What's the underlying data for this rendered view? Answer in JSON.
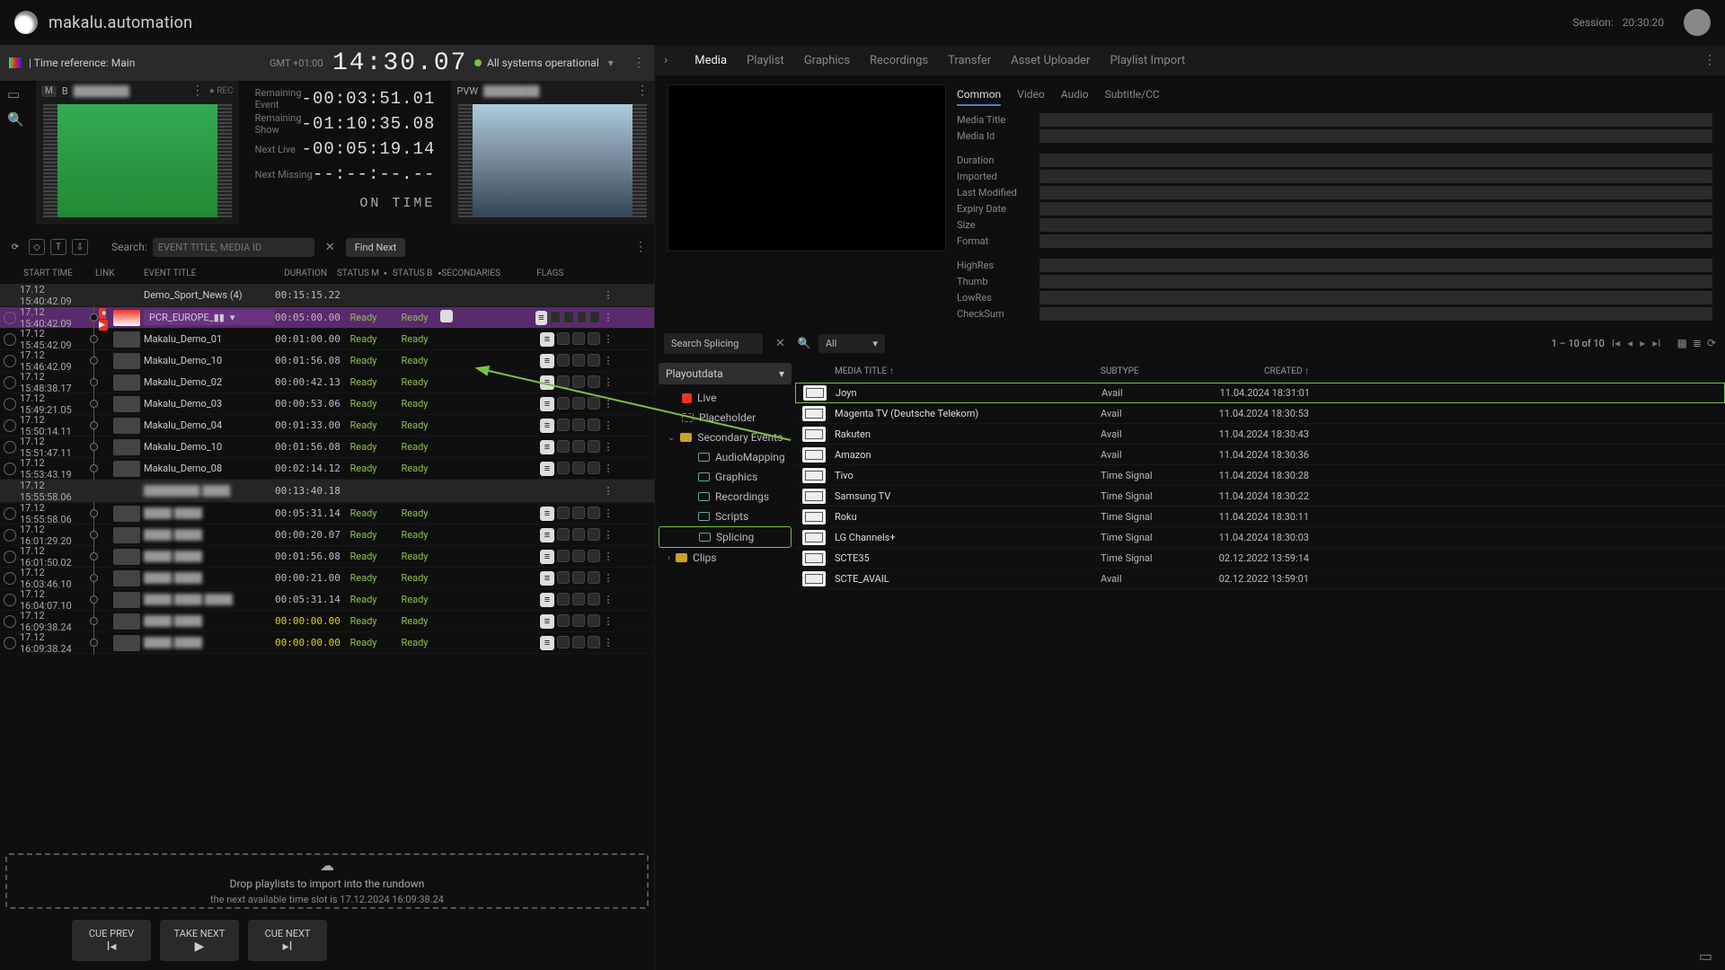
{
  "brand": "makalu.automation",
  "session_label": "Session:",
  "session_time": "20:30:20",
  "left_header": {
    "time_ref": "| Time reference: Main",
    "gmt": "GMT +01:00",
    "clock": "14:30.07",
    "status": "All systems operational"
  },
  "pgm": {
    "badge": "M",
    "ch": "B",
    "title": "████████",
    "rec": "REC"
  },
  "pvw": {
    "label": "PVW",
    "title": "████████"
  },
  "counters": {
    "remaining_event_lbl": "Remaining Event",
    "remaining_event": "-00:03:51.01",
    "remaining_show_lbl": "Remaining Show",
    "remaining_show": "-01:10:35.08",
    "next_live_lbl": "Next Live",
    "next_live": "-00:05:19.14",
    "next_missing_lbl": "Next Missing",
    "next_missing": "--:--:--.--",
    "ontime": "ON TIME"
  },
  "search": {
    "label": "Search:",
    "placeholder": "EVENT TITLE, MEDIA ID",
    "find_next": "Find Next"
  },
  "cols": {
    "start": "START TIME",
    "link": "LINK",
    "title": "EVENT TITLE",
    "dur": "DURATION",
    "sm": "STATUS M",
    "sb": "STATUS B",
    "sec": "SECONDARIES",
    "flags": "FLAGS"
  },
  "rows": [
    {
      "type": "group",
      "start": "17.12 15:40:42.09",
      "title": "Demo_Sport_News (4)",
      "dur": "00:15:15.22"
    },
    {
      "type": "active",
      "start": "17.12 15:40:42.09",
      "title": "PCR_EUROPE_▮▮",
      "dur": "00:05:00.00",
      "sm": "Ready",
      "sb": "Ready",
      "sec": true,
      "flags": "w4"
    },
    {
      "type": "item",
      "start": "17.12 15:45:42.09",
      "title": "Makalu_Demo_01",
      "dur": "00:01:00.00",
      "sm": "Ready",
      "sb": "Ready",
      "flags": "w3"
    },
    {
      "type": "item",
      "start": "17.12 15:46:42.09",
      "title": "Makalu_Demo_10",
      "dur": "00:01:56.08",
      "sm": "Ready",
      "sb": "Ready",
      "flags": "w3"
    },
    {
      "type": "item",
      "start": "17.12 15:48:38.17",
      "title": "Makalu_Demo_02",
      "dur": "00:00:42.13",
      "sm": "Ready",
      "sb": "Ready",
      "flags": "w3"
    },
    {
      "type": "item",
      "start": "17.12 15:49:21.05",
      "title": "Makalu_Demo_03",
      "dur": "00:00:53.06",
      "sm": "Ready",
      "sb": "Ready",
      "flags": "w3"
    },
    {
      "type": "item",
      "start": "17.12 15:50:14.11",
      "title": "Makalu_Demo_04",
      "dur": "00:01:33.00",
      "sm": "Ready",
      "sb": "Ready",
      "flags": "w3"
    },
    {
      "type": "item",
      "start": "17.12 15:51:47.11",
      "title": "Makalu_Demo_10",
      "dur": "00:01:56.08",
      "sm": "Ready",
      "sb": "Ready",
      "flags": "w3"
    },
    {
      "type": "item",
      "start": "17.12 15:53:43.19",
      "title": "Makalu_Demo_08",
      "dur": "00:02:14.12",
      "sm": "Ready",
      "sb": "Ready",
      "flags": "w3"
    },
    {
      "type": "group",
      "start": "17.12 15:55:58.06",
      "title": "████████ ████",
      "dur": "00:13:40.18",
      "blur": true
    },
    {
      "type": "item",
      "start": "17.12 15:55:58.06",
      "title": "████ ████",
      "dur": "00:05:31.14",
      "sm": "Ready",
      "sb": "Ready",
      "flags": "w3",
      "blur": true
    },
    {
      "type": "item",
      "start": "17.12 16:01:29.20",
      "title": "████ ████",
      "dur": "00:00:20.07",
      "sm": "Ready",
      "sb": "Ready",
      "flags": "w3",
      "blur": true
    },
    {
      "type": "item",
      "start": "17.12 16:01:50.02",
      "title": "████ ████",
      "dur": "00:01:56.08",
      "sm": "Ready",
      "sb": "Ready",
      "flags": "w3",
      "blur": true
    },
    {
      "type": "item",
      "start": "17.12 16:03:46.10",
      "title": "████ ████",
      "dur": "00:00:21.00",
      "sm": "Ready",
      "sb": "Ready",
      "flags": "w3",
      "blur": true
    },
    {
      "type": "item",
      "start": "17.12 16:04:07.10",
      "title": "████ ████ ████",
      "dur": "00:05:31.14",
      "sm": "Ready",
      "sb": "Ready",
      "flags": "w3",
      "blur": true
    },
    {
      "type": "item",
      "start": "17.12 16:09:38.24",
      "title": "████ ████",
      "dur": "00:00:00.00",
      "sm": "Ready",
      "sb": "Ready",
      "flags": "w3",
      "blur": true,
      "dur_yellow": true
    },
    {
      "type": "item",
      "start": "17.12 16:09:38.24",
      "title": "████ ████",
      "dur": "00:00:00.00",
      "sm": "Ready",
      "sb": "Ready",
      "flags": "w3",
      "blur": true,
      "dur_yellow": true
    }
  ],
  "dropzone": {
    "line1": "Drop playlists to import into the rundown",
    "line2": "the next available time slot is 17.12.2024 16:09:38.24"
  },
  "transport": {
    "prev": "CUE PREV",
    "take": "TAKE NEXT",
    "next": "CUE NEXT"
  },
  "right_tabs": [
    "Media",
    "Playlist",
    "Graphics",
    "Recordings",
    "Transfer",
    "Asset Uploader",
    "Playlist Import"
  ],
  "right_tabs_active": 0,
  "meta_tabs": [
    "Common",
    "Video",
    "Audio",
    "Subtitle/CC"
  ],
  "meta_tabs_active": 0,
  "meta_labels": [
    "Media Title",
    "Media Id",
    "",
    "Duration",
    "Imported",
    "Last Modified",
    "Expiry Date",
    "Size",
    "Format",
    "",
    "HighRes",
    "Thumb",
    "LowRes",
    "CheckSum"
  ],
  "browser": {
    "search_value": "Search Splicing",
    "filter": "All",
    "pager": "1 – 10 of 10",
    "tree_header": "Playoutdata",
    "tree": [
      {
        "icon": "live",
        "label": "Live"
      },
      {
        "icon": "ph",
        "label": "Placeholder"
      },
      {
        "icon": "folder-y",
        "label": "Secondary Events",
        "exp": true
      },
      {
        "icon": "folder-g",
        "label": "AudioMapping",
        "sub": true
      },
      {
        "icon": "folder-g",
        "label": "Graphics",
        "sub": true
      },
      {
        "icon": "folder-g",
        "label": "Recordings",
        "sub": true
      },
      {
        "icon": "folder-g",
        "label": "Scripts",
        "sub": true
      },
      {
        "icon": "folder-g",
        "label": "Splicing",
        "sub": true,
        "sel": true
      },
      {
        "icon": "folder-y",
        "label": "Clips",
        "chev": true
      }
    ],
    "asset_cols": {
      "title": "MEDIA TITLE",
      "sub": "SUBTYPE",
      "date": "CREATED"
    },
    "assets": [
      {
        "title": "Joyn",
        "sub": "Avail",
        "date": "11.04.2024 18:31:01",
        "hl": true
      },
      {
        "title": "Magenta TV (Deutsche Telekom)",
        "sub": "Avail",
        "date": "11.04.2024 18:30:53"
      },
      {
        "title": "Rakuten",
        "sub": "Avail",
        "date": "11.04.2024 18:30:43"
      },
      {
        "title": "Amazon",
        "sub": "Avail",
        "date": "11.04.2024 18:30:36"
      },
      {
        "title": "Tivo",
        "sub": "Time Signal",
        "date": "11.04.2024 18:30:28"
      },
      {
        "title": "Samsung TV",
        "sub": "Time Signal",
        "date": "11.04.2024 18:30:22"
      },
      {
        "title": "Roku",
        "sub": "Time Signal",
        "date": "11.04.2024 18:30:11"
      },
      {
        "title": "LG Channels+",
        "sub": "Time Signal",
        "date": "11.04.2024 18:30:03"
      },
      {
        "title": "SCTE35",
        "sub": "Time Signal",
        "date": "02.12.2022 13:59:14"
      },
      {
        "title": "SCTE_AVAIL",
        "sub": "Avail",
        "date": "02.12.2022 13:59:01"
      }
    ]
  }
}
